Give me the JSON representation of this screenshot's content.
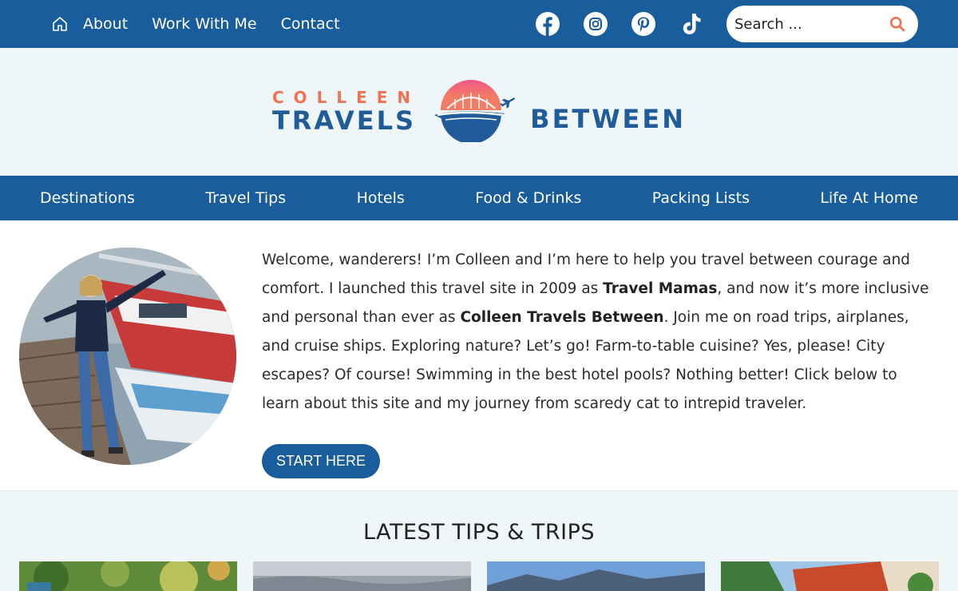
{
  "topbar": {
    "home_icon": "home-icon",
    "links": [
      "About",
      "Work With Me",
      "Contact"
    ],
    "social": [
      "facebook-icon",
      "instagram-icon",
      "pinterest-icon",
      "tiktok-icon"
    ],
    "search_placeholder": "Search ...",
    "colors": {
      "bar": "#1a5d9c",
      "search_icon": "#f07254"
    }
  },
  "logo": {
    "line1": "COLLEEN",
    "line2": "TRAVELS",
    "line3": "BETWEEN",
    "colors": {
      "coral": "#f07254",
      "blue": "#1f5c99"
    }
  },
  "mainnav": {
    "items": [
      "Destinations",
      "Travel Tips",
      "Hotels",
      "Food & Drinks",
      "Packing Lists",
      "Life At Home"
    ]
  },
  "intro": {
    "p1": "Welcome, wanderers! I’m Colleen and I’m here to help you travel between courage and comfort. I launched this travel site in 2009 as ",
    "b1": "Travel Mamas",
    "p2": ", and now it’s more inclusive and personal than ever as ",
    "b2": "Colleen Travels Between",
    "p3": ". Join me on road trips, airplanes, and cruise ships. Exploring nature? Let’s go! Farm-to-table cuisine? Yes, please! City escapes? Of course! Swimming in the best hotel pools? Nothing better! Click below to learn about this site and my journey from scaredy cat to intrepid traveler.",
    "cta": "START HERE"
  },
  "latest": {
    "title": "LATEST TIPS & TRIPS"
  }
}
